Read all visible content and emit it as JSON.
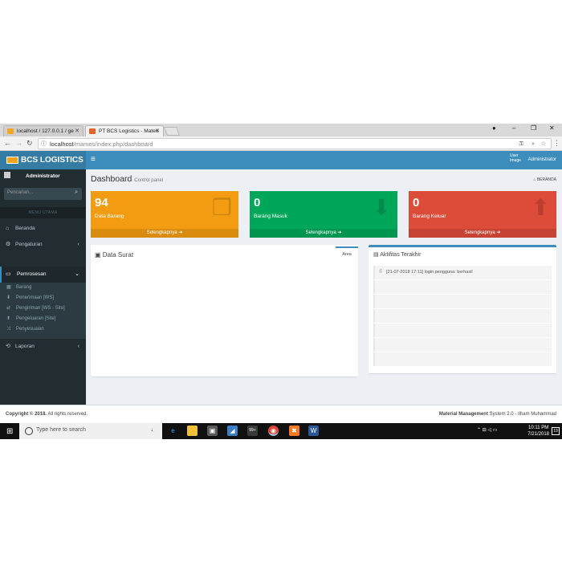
{
  "browser": {
    "tabs": [
      {
        "label": "localhost / 127.0.0.1 / ge"
      },
      {
        "label": "PT BCS Logistics - Materi"
      }
    ],
    "url_host": "localhost",
    "url_path": "/mames/index.php/dashboard"
  },
  "app": {
    "logo": "BCS LOGISTICS",
    "user_name": "Administrator",
    "user_image_alt": "User Image"
  },
  "sidebar": {
    "user": "Administrator",
    "search_placeholder": "Pencarian...",
    "header": "MENU UTAMA",
    "items": [
      {
        "label": "Beranda",
        "icon": "home-icon"
      },
      {
        "label": "Pengaturan",
        "icon": "gears-icon"
      },
      {
        "label": "Pemrosesan",
        "icon": "laptop-icon"
      },
      {
        "label": "Laporan",
        "icon": "history-icon"
      }
    ],
    "submenu": [
      {
        "label": "Barang",
        "icon": "cubes-icon"
      },
      {
        "label": "Penerimaan [WS]",
        "icon": "arrow-down-icon"
      },
      {
        "label": "Pengiriman [WS - Site]",
        "icon": "exchange-icon"
      },
      {
        "label": "Pengeluaran [Site]",
        "icon": "arrow-up-icon"
      },
      {
        "label": "Penyesuaian",
        "icon": "random-icon"
      }
    ]
  },
  "content": {
    "title": "Dashboard",
    "subtitle": "Control panel",
    "breadcrumb": "BERANDA",
    "boxes": [
      {
        "value": "94",
        "label": "Data Barang",
        "link": "Selengkapnya",
        "color": "#f39c12"
      },
      {
        "value": "0",
        "label": "Barang Masuk",
        "link": "Selengkapnya",
        "color": "#00a65a"
      },
      {
        "value": "0",
        "label": "Barang Keluar",
        "link": "Selengkapnya",
        "color": "#dd4b39"
      }
    ],
    "data_surat": {
      "title": "Data Surat",
      "tab": "Area"
    },
    "aktifitas": {
      "title": "Aktifitas Terakhir",
      "items": [
        "[21-07-2018 17:11] login pengguna: berhasil"
      ]
    }
  },
  "footer": {
    "copyright": "Copyright © 2018.",
    "rights": "All rights reserved.",
    "product_bold": "Material Management",
    "product_rest": "System 2.0 - Ilham Muhammad"
  },
  "taskbar": {
    "search_placeholder": "Type here to search",
    "time": "10:11 PM",
    "date": "7/21/2018",
    "badge": "99+",
    "notifications": "19"
  }
}
